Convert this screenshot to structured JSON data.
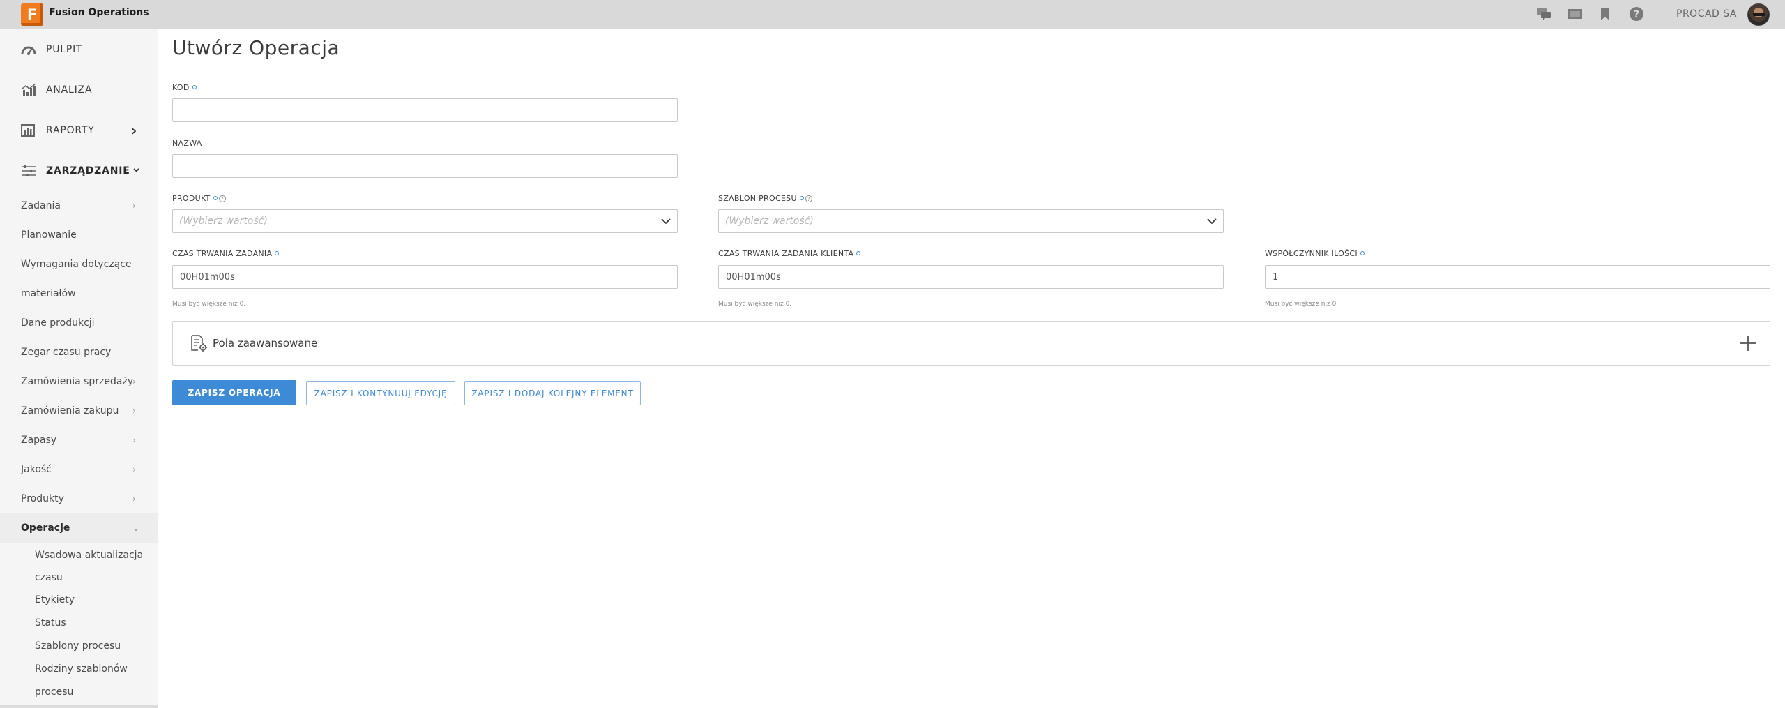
{
  "app": {
    "logo_letter": "F",
    "title": "Fusion Operations",
    "company": "PROCAD SA"
  },
  "header_icons": [
    "chat-icon",
    "film-icon",
    "bookmark-icon",
    "help-icon"
  ],
  "sidebar": {
    "main": [
      {
        "label": "PULPIT",
        "icon": "dashboard-icon"
      },
      {
        "label": "ANALIZA",
        "icon": "analytics-icon"
      },
      {
        "label": "RAPORTY",
        "icon": "reports-icon",
        "arrow": "›"
      },
      {
        "label": "ZARZĄDZANIE",
        "icon": "sliders-icon",
        "arrow": "⌄"
      }
    ],
    "sub": [
      {
        "label": "Zadania",
        "chev": "›"
      },
      {
        "label": "Planowanie",
        "chev": ""
      },
      {
        "label": "Wymagania dotyczące",
        "chev": ""
      },
      {
        "label": "materiałów",
        "chev": ""
      },
      {
        "label": "Dane produkcji",
        "chev": ""
      },
      {
        "label": "Zegar czasu pracy",
        "chev": ""
      },
      {
        "label": "Zamówienia sprzedaży",
        "chev": "›"
      },
      {
        "label": "Zamówienia zakupu",
        "chev": "›"
      },
      {
        "label": "Zapasy",
        "chev": "›"
      },
      {
        "label": "Jakość",
        "chev": "›"
      },
      {
        "label": "Produkty",
        "chev": "›"
      },
      {
        "label": "Operacje",
        "chev": "⌄"
      }
    ],
    "subsub": [
      "Wsadowa aktualizacja",
      "czasu",
      "Etykiety",
      "Status",
      "Szablony procesu",
      "Rodziny szablonów",
      "procesu"
    ]
  },
  "form": {
    "title": "Utwórz Operacja",
    "kod_label": "KOD",
    "nazwa_label": "NAZWA",
    "produkt_label": "PRODUKT",
    "produkt_placeholder": "(Wybierz wartość)",
    "szablon_label": "SZABLON PROCESU",
    "szablon_placeholder": "(Wybierz wartość)",
    "czas_label": "CZAS TRWANIA ZADANIA",
    "czas_value": "00H01m00s",
    "czas_klienta_label": "CZAS TRWANIA ZADANIA KLIENTA",
    "czas_klienta_value": "00H01m00s",
    "wspolczynnik_label": "WSPÓŁCZYNNIK ILOŚCI",
    "wspolczynnik_value": "1",
    "hint": "Musi być większe niż 0.",
    "advanced_label": "Pola zaawansowane"
  },
  "buttons": {
    "save": "ZAPISZ OPERACJA",
    "save_continue": "ZAPISZ I KONTYNUUJ EDYCJĘ",
    "save_add": "ZAPISZ I DODAJ KOLEJNY ELEMENT"
  },
  "colors": {
    "accent": "#3d8ad6",
    "logo": "#f07c1f",
    "topbar": "#d9d9d9",
    "sidebar": "#f5f5f5"
  }
}
